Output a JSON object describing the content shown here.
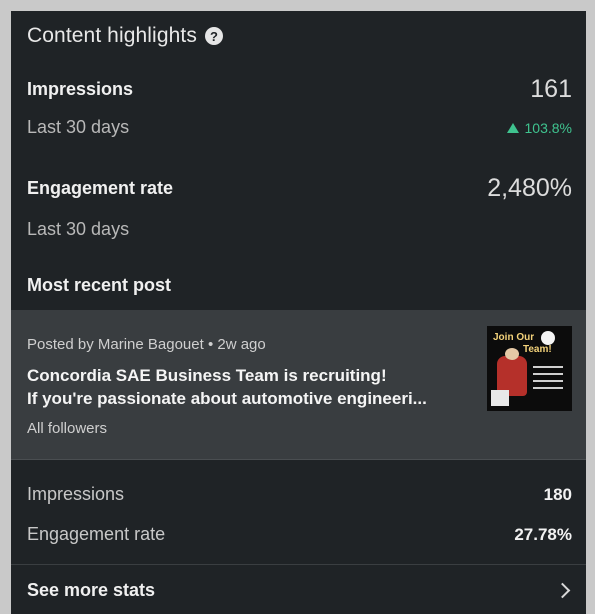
{
  "header": {
    "title": "Content highlights",
    "help_icon": "question-circle-icon"
  },
  "impressions": {
    "label": "Impressions",
    "value": "161",
    "period": "Last 30 days",
    "trend": "103.8%",
    "trend_direction": "up",
    "trend_color": "#3fc38f"
  },
  "engagement": {
    "label": "Engagement rate",
    "value": "2,480%",
    "period": "Last 30 days"
  },
  "recent_post": {
    "section_title": "Most recent post",
    "meta": "Posted by Marine Bagouet • 2w ago",
    "title_line1": "Concordia SAE Business Team is recruiting!",
    "title_line2": "If you're passionate about automotive engineeri...",
    "audience": "All followers",
    "thumbnail_text_1": "Join Our",
    "thumbnail_text_2": "Team!",
    "stats": [
      {
        "label": "Impressions",
        "value": "180"
      },
      {
        "label": "Engagement rate",
        "value": "27.78%"
      }
    ]
  },
  "footer": {
    "see_more_label": "See more stats",
    "chevron_icon": "chevron-right-icon"
  },
  "colors": {
    "panel_background": "#1f2326",
    "card_background": "#393d40",
    "positive": "#3fc38f"
  }
}
